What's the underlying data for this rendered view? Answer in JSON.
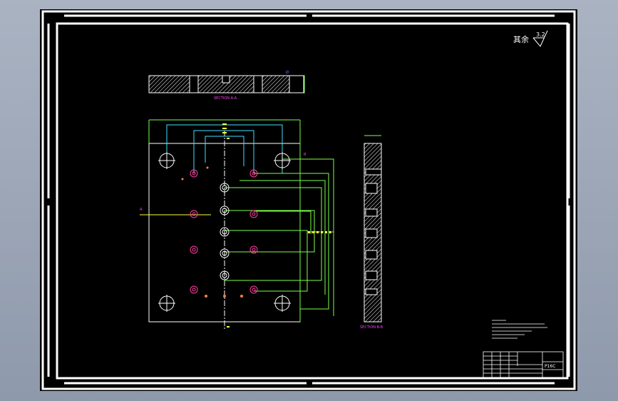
{
  "drawing": {
    "roughness_label": "其余",
    "roughness_value": "3.2",
    "section_top_label": "SECTION A-A",
    "section_side_label": "SECTION B-B",
    "title_block_code": "P16C"
  },
  "colors": {
    "background": "#000000",
    "outline": "#ffffff",
    "hatch": "#ffffff",
    "hole": "#ff3fa0",
    "leader": "#7cff4a",
    "dimension": "#ffff40",
    "cyan": "#40e0ff",
    "magenta": "#ff40ff",
    "blue": "#6080ff"
  }
}
